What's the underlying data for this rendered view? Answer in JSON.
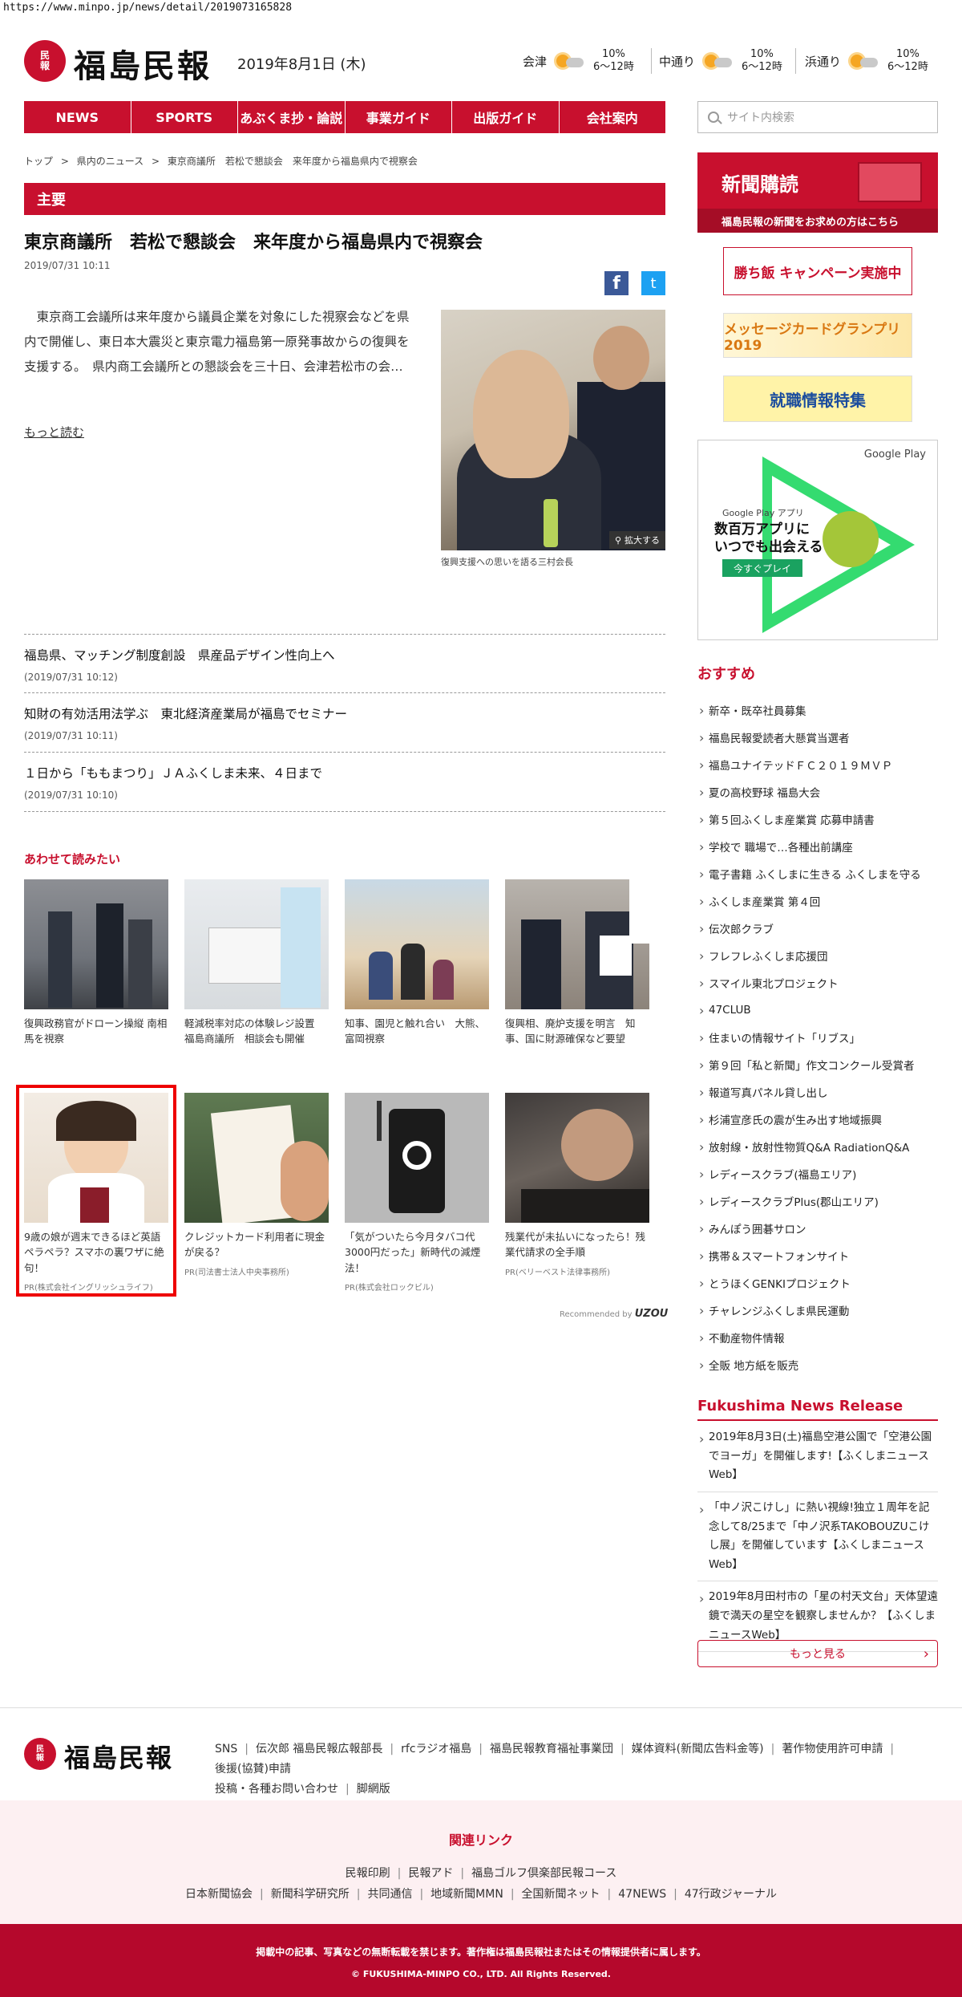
{
  "browser": {
    "url": "https://www.minpo.jp/news/detail/2019073165828"
  },
  "header": {
    "logo_seal_top": "民",
    "logo_seal_bottom": "報",
    "logo_text": "福島民報",
    "date": "2019年8月1日 (木)",
    "weather": [
      {
        "city": "会津",
        "percent": "10%",
        "hours": "6〜12時"
      },
      {
        "city": "中通り",
        "percent": "10%",
        "hours": "6〜12時"
      },
      {
        "city": "浜通り",
        "percent": "10%",
        "hours": "6〜12時"
      }
    ]
  },
  "nav": {
    "items": [
      "NEWS",
      "SPORTS",
      "あぶくま抄・論説",
      "事業ガイド",
      "出版ガイド",
      "会社案内"
    ]
  },
  "search": {
    "placeholder": "サイト内検索"
  },
  "breadcrumb": [
    "トップ",
    ">",
    "県内のニュース",
    ">",
    "東京商議所　若松で懇談会　来年度から福島県内で視察会"
  ],
  "section": {
    "label": "主要"
  },
  "article": {
    "title": "東京商議所　若松で懇談会　来年度から福島県内で視察会",
    "date": "2019/07/31 10:11",
    "body": "東京商工会議所は来年度から議員企業を対象にした視察会などを県内で開催し、東日本大震災と東京電力福島第一原発事故からの復興を支援する。　県内商工会議所との懇談会を三十日、会津若松市の会…",
    "more": "もっと読む",
    "zoom": "拡大する",
    "caption": "復興支援への思いを語る三村会長"
  },
  "share": {
    "facebook": "f",
    "twitter": "t"
  },
  "news_list": [
    {
      "title": "福島県、マッチング制度創設　県産品デザイン性向上へ",
      "date": "(2019/07/31 10:12)"
    },
    {
      "title": "知財の有効活用法学ぶ　東北経済産業局が福島でセミナー",
      "date": "(2019/07/31 10:11)"
    },
    {
      "title": "１日から「ももまつり」ＪＡふくしま未来、４日まで",
      "date": "(2019/07/31 10:10)"
    }
  ],
  "related": {
    "heading": "あわせて読みたい",
    "row1": [
      {
        "caption": "復興政務官がドローン操縦 南相馬を視察",
        "pr": ""
      },
      {
        "caption": "軽減税率対応の体験レジ設置　福島商議所　相談会も開催",
        "pr": ""
      },
      {
        "caption": "知事、園児と触れ合い　大熊、富岡視察",
        "pr": ""
      },
      {
        "caption": "復興相、廃炉支援を明言　知事、国に財源確保など要望",
        "pr": ""
      }
    ],
    "row2": [
      {
        "caption": "9歳の娘が週末できるほど英語ペラペラ？スマホの裏ワザに絶句！",
        "pr": "PR(株式会社イングリッシュライフ)"
      },
      {
        "caption": "クレジットカード利用者に現金が戻る？",
        "pr": "PR(司法書士法人中央事務所)"
      },
      {
        "caption": "「気がついたら今月タバコ代3000円だった」新時代の減煙法！",
        "pr": "PR(株式会社ロックビル)"
      },
      {
        "caption": "残業代が未払いになったら！残業代請求の全手順",
        "pr": "PR(ベリーベスト法律事務所)"
      }
    ],
    "recommended_by": "Recommended by",
    "recommended_brand": "UZOU"
  },
  "sidebar": {
    "subscribe_title": "新聞購読",
    "subscribe_sub": "福島民報の新聞をお求めの方はこちら",
    "banner1": "勝ち飯 キャンペーン実施中",
    "banner2": "メッセージカードグランプリ2019",
    "banner3": "就職情報特集",
    "googleplay": {
      "title": "Google Play",
      "app": "Google Play アプリ",
      "headline": "数百万アプリに\nいつでも出会える",
      "button": "今すぐプレイ"
    },
    "recommend_heading": "おすすめ",
    "recommend": [
      "新卒・既卒社員募集",
      "福島民報愛読者大懸賞当選者",
      "福島ユナイテッドＦＣ２０１９ＭＶＰ",
      "夏の高校野球 福島大会",
      "第５回ふくしま産業賞 応募申請書",
      "学校で 職場で…各種出前講座",
      "電子書籍 ふくしまに生きる ふくしまを守る",
      "ふくしま産業賞 第４回",
      "伝次郎クラブ",
      "フレフレふくしま応援団",
      "スマイル東北プロジェクト",
      "47CLUB",
      "住まいの情報サイト「リブス」",
      "第９回「私と新聞」作文コンクール受賞者",
      "報道写真パネル貸し出し",
      "杉浦宣彦氏の震が生み出す地域振興",
      "放射線・放射性物質Q&A RadiationQ&A",
      "レディースクラブ(福島エリア)",
      "レディースクラブPlus(郡山エリア)",
      "みんぽう囲碁サロン",
      "携帯＆スマートフォンサイト",
      "とうほくGENKIプロジェクト",
      "チャレンジふくしま県民運動",
      "不動産物件情報",
      "全販 地方紙を販売"
    ],
    "release_heading": "Fukushima News Release",
    "release": [
      "2019年8月3日(土)福島空港公園で「空港公園でヨーガ」を開催します!【ふくしまニュースWeb】",
      "「中ノ沢こけし」に熱い視線!独立１周年を記念して8/25まで「中ノ沢系TAKOBOUZUこけし展」を開催しています【ふくしまニュースWeb】",
      "2019年8月田村市の「星の村天文台」天体望遠鏡で満天の星空を観察しませんか？【ふくしまニュースWeb】"
    ],
    "more": "もっと見る"
  },
  "footer": {
    "logo_text": "福島民報",
    "links": [
      "SNS",
      "伝次郎 福島民報広報部長",
      "rfcラジオ福島",
      "福島民報教育福祉事業団",
      "媒体資料(新聞広告料金等)",
      "著作物使用許可申請",
      "後援(協賛)申請",
      "投稿・各種お問い合わせ",
      "脚網版"
    ],
    "related_heading": "関連リンク",
    "related_row1": [
      "民報印刷",
      "民報アド",
      "福島ゴルフ倶楽部民報コース"
    ],
    "related_row2": [
      "日本新聞協会",
      "新聞科学研究所",
      "共同通信",
      "地域新聞MMN",
      "全国新聞ネット",
      "47NEWS",
      "47行政ジャーナル"
    ],
    "notice": "掲載中の記事、写真などの無断転載を禁じます。著作権は福島民報社またはその情報提供者に属します。",
    "copyright": "© FUKUSHIMA-MINPO CO., LTD. All Rights Reserved."
  },
  "colors": {
    "brand": "#c8102e",
    "highlight": "#ee0000"
  }
}
